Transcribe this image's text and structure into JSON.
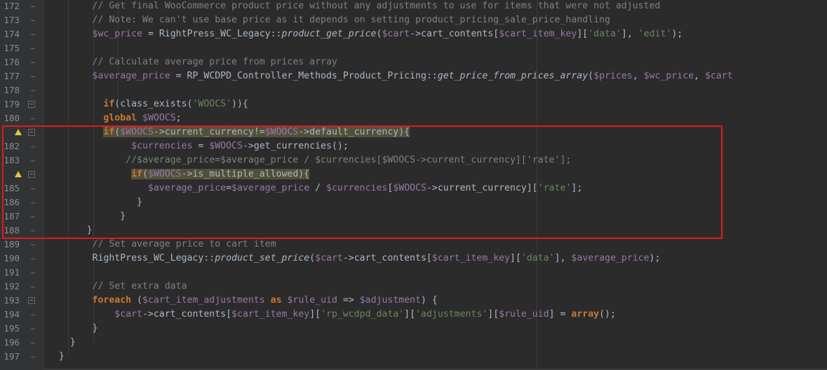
{
  "editor": {
    "colors": {
      "background": "#2b2b2b",
      "gutter": "#313335",
      "comment": "#808080",
      "variable": "#9876aa",
      "keyword": "#cc7832",
      "string": "#6a8759",
      "default_text": "#a9b7c6",
      "highlight_box": "#e31a1a"
    },
    "lines": [
      {
        "num": "172",
        "fold": false,
        "warn": false,
        "tokens": [
          {
            "t": "        "
          },
          {
            "t": "// Get final WooCommerce product price without any adjustments to use for items that were not adjusted",
            "c": "cm"
          }
        ]
      },
      {
        "num": "173",
        "fold": false,
        "warn": false,
        "tokens": [
          {
            "t": "        "
          },
          {
            "t": "// Note: We can't use base price as it depends on setting product_pricing_sale_price_handling",
            "c": "cm"
          }
        ]
      },
      {
        "num": "174",
        "fold": false,
        "warn": false,
        "tokens": [
          {
            "t": "        "
          },
          {
            "t": "$wc_price",
            "c": "var"
          },
          {
            "t": " = RightPress_WC_Legacy::"
          },
          {
            "t": "product_get_price",
            "c": "fn-it"
          },
          {
            "t": "("
          },
          {
            "t": "$cart",
            "c": "var"
          },
          {
            "t": "->cart_contents["
          },
          {
            "t": "$cart_item_key",
            "c": "var"
          },
          {
            "t": "]["
          },
          {
            "t": "'data'",
            "c": "str"
          },
          {
            "t": "], "
          },
          {
            "t": "'edit'",
            "c": "str"
          },
          {
            "t": ");"
          }
        ]
      },
      {
        "num": "175",
        "fold": false,
        "warn": false,
        "tokens": [
          {
            "t": ""
          }
        ]
      },
      {
        "num": "176",
        "fold": false,
        "warn": false,
        "tokens": [
          {
            "t": "        "
          },
          {
            "t": "// Calculate average price from prices array",
            "c": "cm"
          }
        ]
      },
      {
        "num": "177",
        "fold": false,
        "warn": false,
        "tokens": [
          {
            "t": "        "
          },
          {
            "t": "$average_price",
            "c": "var"
          },
          {
            "t": " = RP_WCDPD_Controller_Methods_Product_Pricing::"
          },
          {
            "t": "get_price_from_prices_array",
            "c": "fn-it"
          },
          {
            "t": "("
          },
          {
            "t": "$prices",
            "c": "var"
          },
          {
            "t": ", "
          },
          {
            "t": "$wc_price",
            "c": "var"
          },
          {
            "t": ", "
          },
          {
            "t": "$cart",
            "c": "var"
          }
        ]
      },
      {
        "num": "178",
        "fold": false,
        "warn": false,
        "tokens": [
          {
            "t": ""
          }
        ]
      },
      {
        "num": "179",
        "fold": true,
        "warn": false,
        "tokens": [
          {
            "t": "          "
          },
          {
            "t": "if",
            "c": "kw"
          },
          {
            "t": "(class_exists("
          },
          {
            "t": "'WOOCS'",
            "c": "str"
          },
          {
            "t": ")){"
          }
        ]
      },
      {
        "num": "180",
        "fold": false,
        "warn": false,
        "tokens": [
          {
            "t": "          "
          },
          {
            "t": "global",
            "c": "kw"
          },
          {
            "t": " "
          },
          {
            "t": "$WOOCS",
            "c": "var"
          },
          {
            "t": ";"
          }
        ]
      },
      {
        "num": "",
        "fold": true,
        "warn": true,
        "tokens": [
          {
            "t": "          "
          },
          {
            "t": "if",
            "c": "kw hl"
          },
          {
            "t": "(",
            "c": "hl"
          },
          {
            "t": "$WOOCS",
            "c": "var hl"
          },
          {
            "t": "->current_currency!=",
            "c": "hl"
          },
          {
            "t": "$WOOCS",
            "c": "var hl"
          },
          {
            "t": "->default_currency){",
            "c": "hl"
          }
        ]
      },
      {
        "num": "182",
        "fold": false,
        "warn": false,
        "tokens": [
          {
            "t": "               "
          },
          {
            "t": "$currencies",
            "c": "var"
          },
          {
            "t": " = "
          },
          {
            "t": "$WOOCS",
            "c": "var"
          },
          {
            "t": "->get_currencies();"
          }
        ]
      },
      {
        "num": "183",
        "fold": false,
        "warn": false,
        "tokens": [
          {
            "t": "              "
          },
          {
            "t": "//$average_price=$average_price / $currencies[$WOOCS->current_currency]['rate'];",
            "c": "cm"
          }
        ]
      },
      {
        "num": "",
        "fold": true,
        "warn": true,
        "tokens": [
          {
            "t": "               "
          },
          {
            "t": "if",
            "c": "kw hl"
          },
          {
            "t": "(",
            "c": "hl"
          },
          {
            "t": "$WOOCS",
            "c": "var hl"
          },
          {
            "t": "->is_multiple_allowed){",
            "c": "hl"
          }
        ]
      },
      {
        "num": "185",
        "fold": false,
        "warn": false,
        "tokens": [
          {
            "t": "                  "
          },
          {
            "t": "$average_price",
            "c": "var"
          },
          {
            "t": "="
          },
          {
            "t": "$average_price",
            "c": "var"
          },
          {
            "t": " / "
          },
          {
            "t": "$currencies",
            "c": "var"
          },
          {
            "t": "["
          },
          {
            "t": "$WOOCS",
            "c": "var"
          },
          {
            "t": "->current_currency]["
          },
          {
            "t": "'rate'",
            "c": "str"
          },
          {
            "t": "];"
          }
        ]
      },
      {
        "num": "186",
        "fold": false,
        "warn": false,
        "tokens": [
          {
            "t": "                }"
          }
        ]
      },
      {
        "num": "187",
        "fold": false,
        "warn": false,
        "tokens": [
          {
            "t": "             }"
          }
        ]
      },
      {
        "num": "188",
        "fold": false,
        "warn": false,
        "tokens": [
          {
            "t": "       }"
          }
        ]
      },
      {
        "num": "189",
        "fold": false,
        "warn": false,
        "tokens": [
          {
            "t": "        "
          },
          {
            "t": "// Set average price to cart item",
            "c": "cm"
          }
        ]
      },
      {
        "num": "190",
        "fold": false,
        "warn": false,
        "tokens": [
          {
            "t": "        RightPress_WC_Legacy::"
          },
          {
            "t": "product_set_price",
            "c": "fn-it"
          },
          {
            "t": "("
          },
          {
            "t": "$cart",
            "c": "var"
          },
          {
            "t": "->cart_contents["
          },
          {
            "t": "$cart_item_key",
            "c": "var"
          },
          {
            "t": "]["
          },
          {
            "t": "'data'",
            "c": "str"
          },
          {
            "t": "], "
          },
          {
            "t": "$average_price",
            "c": "var"
          },
          {
            "t": ");"
          }
        ]
      },
      {
        "num": "191",
        "fold": false,
        "warn": false,
        "tokens": [
          {
            "t": ""
          }
        ]
      },
      {
        "num": "192",
        "fold": false,
        "warn": false,
        "tokens": [
          {
            "t": "        "
          },
          {
            "t": "// Set extra data",
            "c": "cm"
          }
        ]
      },
      {
        "num": "193",
        "fold": true,
        "warn": false,
        "tokens": [
          {
            "t": "        "
          },
          {
            "t": "foreach",
            "c": "kw"
          },
          {
            "t": " ("
          },
          {
            "t": "$cart_item_adjustments",
            "c": "var"
          },
          {
            "t": " "
          },
          {
            "t": "as",
            "c": "kw"
          },
          {
            "t": " "
          },
          {
            "t": "$rule_uid",
            "c": "var"
          },
          {
            "t": " => "
          },
          {
            "t": "$adjustment",
            "c": "var"
          },
          {
            "t": ") {"
          }
        ]
      },
      {
        "num": "194",
        "fold": false,
        "warn": false,
        "tokens": [
          {
            "t": "            "
          },
          {
            "t": "$cart",
            "c": "var"
          },
          {
            "t": "->cart_contents["
          },
          {
            "t": "$cart_item_key",
            "c": "var"
          },
          {
            "t": "]["
          },
          {
            "t": "'rp_wcdpd_data'",
            "c": "str"
          },
          {
            "t": "]["
          },
          {
            "t": "'adjustments'",
            "c": "str"
          },
          {
            "t": "]["
          },
          {
            "t": "$rule_uid",
            "c": "var"
          },
          {
            "t": "] = "
          },
          {
            "t": "array",
            "c": "kw"
          },
          {
            "t": "();"
          }
        ]
      },
      {
        "num": "195",
        "fold": false,
        "warn": false,
        "tokens": [
          {
            "t": "        }"
          }
        ]
      },
      {
        "num": "196",
        "fold": false,
        "warn": false,
        "tokens": [
          {
            "t": "    }"
          }
        ]
      },
      {
        "num": "197",
        "fold": false,
        "warn": false,
        "tokens": [
          {
            "t": "  }"
          }
        ]
      }
    ]
  }
}
